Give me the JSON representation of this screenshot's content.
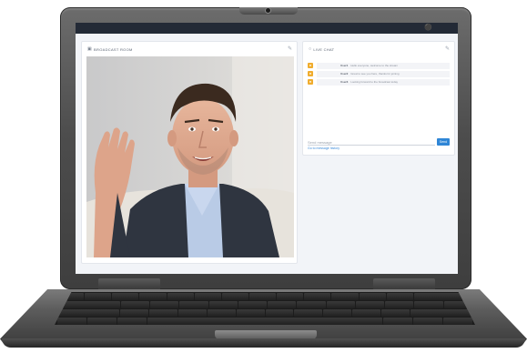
{
  "broadcast_panel": {
    "title": "BROADCAST ROOM",
    "header_icon": "video-camera-icon",
    "corner_icon": "pencil-icon"
  },
  "chat_panel": {
    "title": "LIVE CHAT",
    "header_icon": "chat-icon",
    "corner_icon": "pencil-icon",
    "messages": [
      {
        "user": "User1",
        "text": "Hello everyone, welcome to the stream"
      },
      {
        "user": "User2",
        "text": "Great to see you here, thanks for joining"
      },
      {
        "user": "User3",
        "text": "Looking forward to the broadcast today"
      }
    ],
    "input_placeholder": "Send message",
    "send_label": "Send",
    "link_text": "Go to message history"
  },
  "top_bar": {
    "user_icon": "user-icon"
  },
  "colors": {
    "top_bar": "#232a36",
    "accent": "#2f86d6",
    "avatar": "#f0ad2e",
    "suit": "#2f3540",
    "shirt": "#b9cbe6"
  }
}
